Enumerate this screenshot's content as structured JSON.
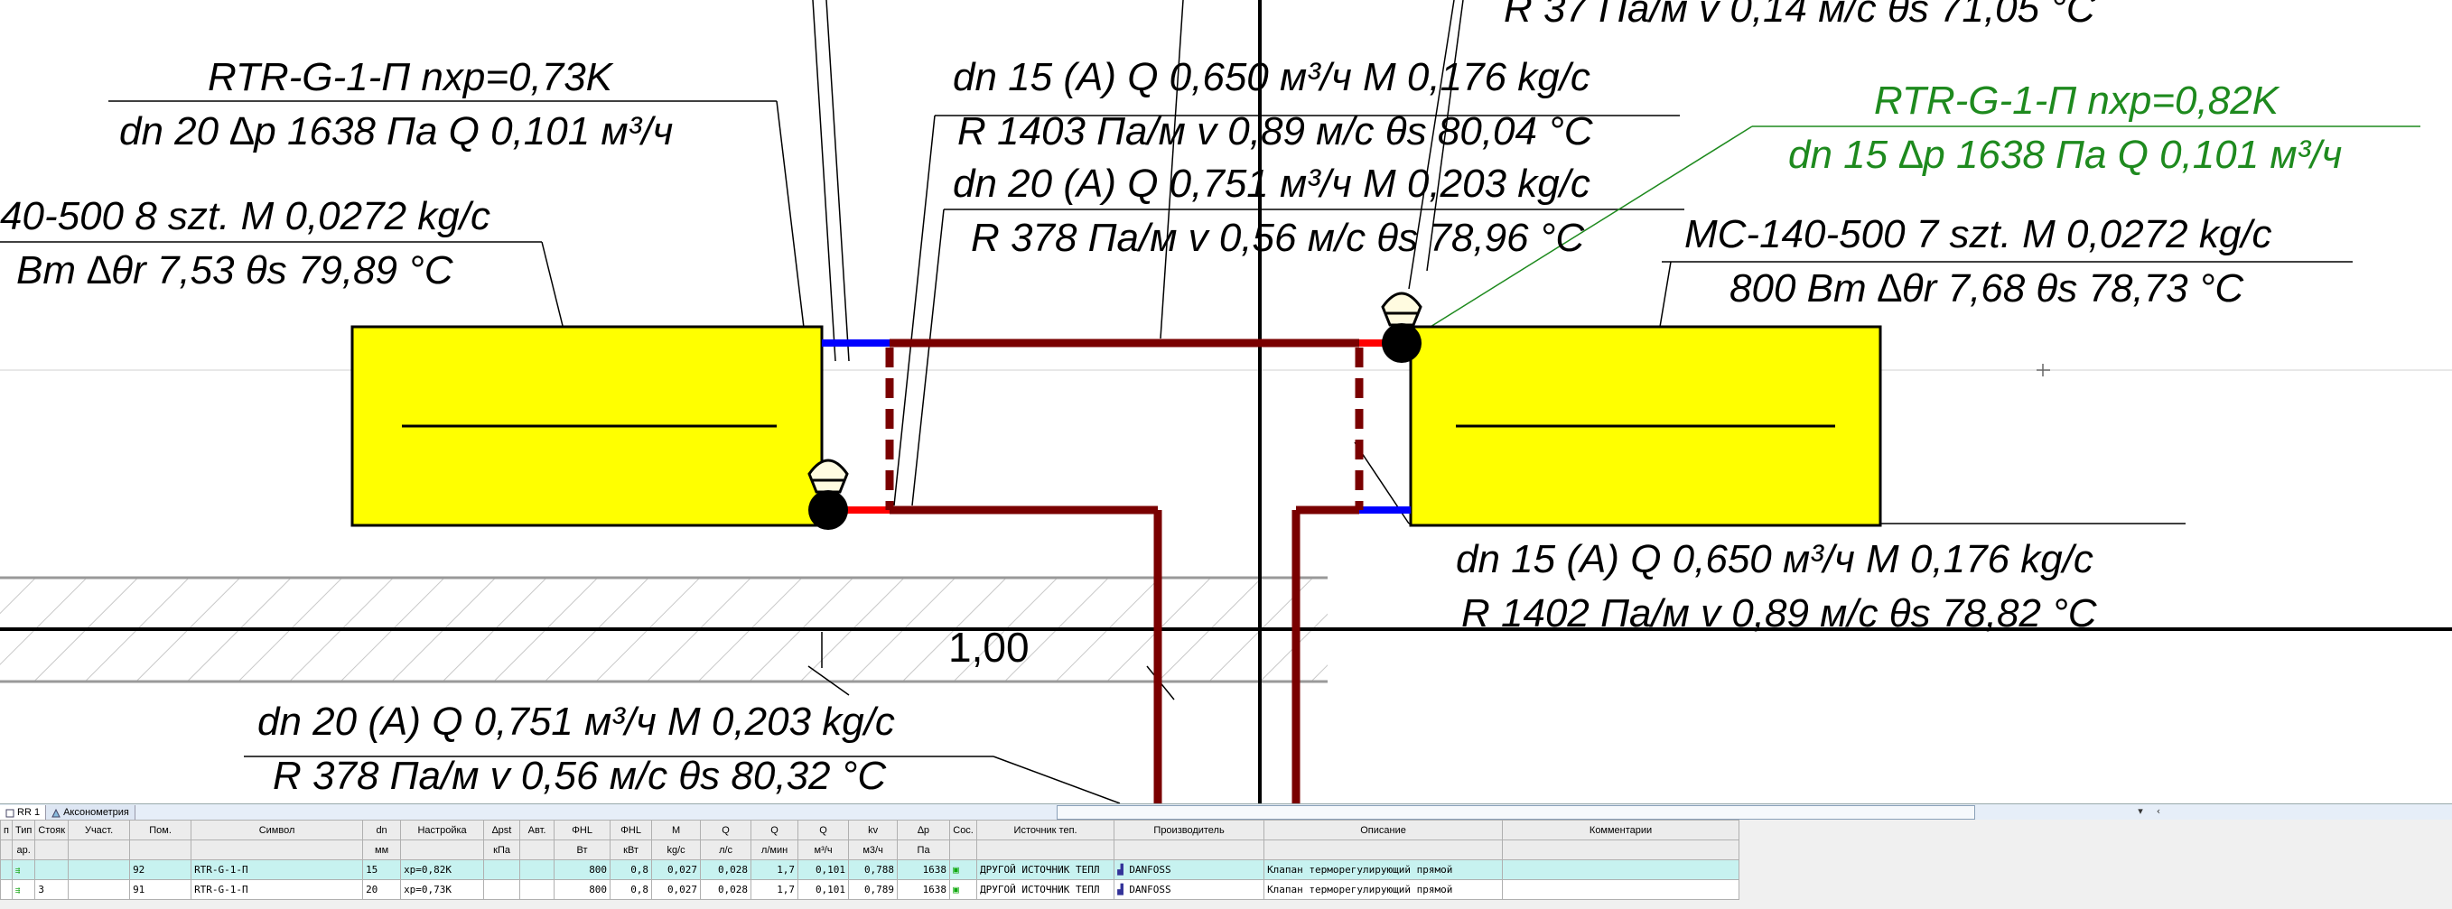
{
  "drawing": {
    "annotations": {
      "top_cut": "R 37 Па/м v 0,14 м/с θs 71,05 °C",
      "left_valve_1": "RTR-G-1-П nxp=0,73K",
      "left_valve_2": "dn 20 ∆p 1638 Па Q 0,101 м³/ч",
      "left_rad_1": "40-500 8 szt. M 0,0272 kg/c",
      "left_rad_2": "Вт ∆θr 7,53 θs 79,89 °C",
      "pipe_a_1": "dn 15 (A) Q 0,650 м³/ч M 0,176 kg/c",
      "pipe_a_2": "R 1403 Па/м v 0,89 м/с θs 80,04 °C",
      "pipe_b_1": "dn 20 (A) Q 0,751 м³/ч M 0,203 kg/c",
      "pipe_b_2": "R 378 Па/м v 0,56 м/с θs 78,96 °C",
      "right_valve_1": "RTR-G-1-П nxp=0,82K",
      "right_valve_2": "dn 15 ∆p 1638 Па Q 0,101 м³/ч",
      "right_rad_1": "MC-140-500 7 szt. M 0,0272 kg/c",
      "right_rad_2": "800 Вт ∆θr 7,68 θs 78,73 °C",
      "right_pipe_1": "dn 15 (A) Q 0,650 м³/ч M 0,176 kg/c",
      "right_pipe_2": "R 1402 Па/м v 0,89 м/с θs 78,82 °C",
      "bottom_pipe_1": "dn 20 (A) Q 0,751 м³/ч M 0,203 kg/c",
      "bottom_pipe_2": "R 378 Па/м v 0,56 м/с θs 80,32 °C",
      "level": "1,00"
    }
  },
  "tabs": [
    {
      "label": "RR 1"
    },
    {
      "label": "Аксонометрия"
    }
  ],
  "table": {
    "headers": [
      "п",
      "Тип",
      "Стояк",
      "Участ.",
      "Пом.",
      "Символ",
      "dn",
      "Настройка",
      "∆pst",
      "Авт.",
      "ΦHL",
      "ΦHL",
      "M",
      "Q",
      "Q",
      "Q",
      "kv",
      "∆p",
      "Сос.",
      "Источник теп.",
      "Производитель",
      "Описание",
      "Комментарии"
    ],
    "units": [
      "",
      "ар.",
      "",
      "",
      "",
      "",
      "мм",
      "",
      "кПа",
      "",
      "Вт",
      "кВт",
      "kg/c",
      "л/с",
      "л/мин",
      "м³/ч",
      "м3/ч",
      "Па",
      "",
      "",
      "",
      "",
      ""
    ],
    "rows": [
      {
        "num": "",
        "type": "",
        "riser": "",
        "segment": "",
        "room": "92",
        "symbol": "RTR-G-1-П",
        "dn": "15",
        "setting": "xp=0,82K",
        "dpst": "",
        "auto": "",
        "phi_w": "800",
        "phi_kw": "0,8",
        "m": "0,027",
        "q_ls": "0,028",
        "q_lmin": "1,7",
        "q_m3h": "0,101",
        "kv": "0,788",
        "dp": "1638",
        "source": "ДРУГОЙ ИСТОЧНИК ТЕПЛ",
        "producer": "DANFOSS",
        "description": "Клапан терморегулирующий прямой",
        "comment": ""
      },
      {
        "num": "",
        "type": "",
        "riser": "3",
        "segment": "",
        "room": "91",
        "symbol": "RTR-G-1-П",
        "dn": "20",
        "setting": "xp=0,73K",
        "dpst": "",
        "auto": "",
        "phi_w": "800",
        "phi_kw": "0,8",
        "m": "0,027",
        "q_ls": "0,028",
        "q_lmin": "1,7",
        "q_m3h": "0,101",
        "kv": "0,789",
        "dp": "1638",
        "source": "ДРУГОЙ ИСТОЧНИК ТЕПЛ",
        "producer": "DANFOSS",
        "description": "Клапан терморегулирующий прямой",
        "comment": ""
      }
    ]
  },
  "colors": {
    "radiator": "#ffff00",
    "pipe_supply": "#7a0000",
    "pipe_red": "#ff0000",
    "pipe_blue": "#0000ff",
    "green_text": "#1e8a1e",
    "selected_row": "#c7f2f0"
  }
}
